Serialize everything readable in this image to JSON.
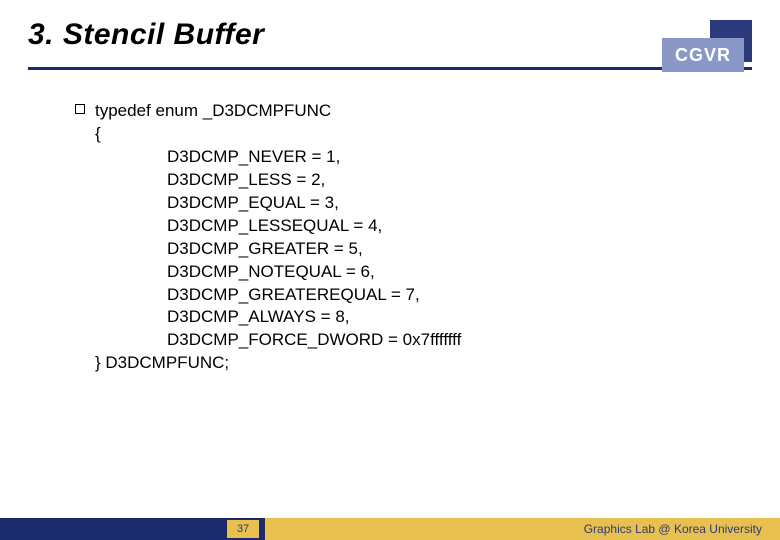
{
  "title": "3. Stencil Buffer",
  "logo": "CGVR",
  "code": {
    "decl": "typedef enum _D3DCMPFUNC",
    "open": "{",
    "lines": [
      "D3DCMP_NEVER = 1,",
      "D3DCMP_LESS = 2,",
      "D3DCMP_EQUAL = 3,",
      "D3DCMP_LESSEQUAL = 4,",
      "D3DCMP_GREATER = 5,",
      "D3DCMP_NOTEQUAL = 6,",
      "D3DCMP_GREATEREQUAL = 7,",
      "D3DCMP_ALWAYS = 8,",
      "D3DCMP_FORCE_DWORD = 0x7fffffff"
    ],
    "close": "} D3DCMPFUNC;"
  },
  "page_number": "37",
  "footer_label": "Graphics Lab @ Korea University",
  "colors": {
    "navy": "#1a2a6c",
    "gold": "#e8c050",
    "logo_light": "#8a98c8"
  }
}
